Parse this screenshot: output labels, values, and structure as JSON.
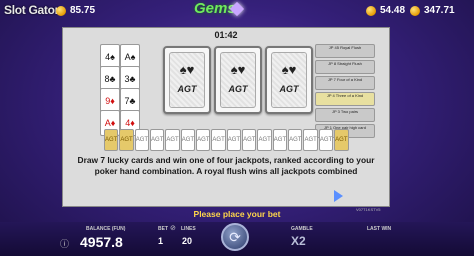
{
  "topbar": {
    "site_name": "Slot Gator",
    "left_balance": "85.75",
    "coin_value": "54.48",
    "total_value": "347.71",
    "game_logo": "Gems"
  },
  "game": {
    "timer": "01:42",
    "deck_cards": [
      "4♠",
      "A♠",
      "8♣",
      "3♣",
      "9♦",
      "7♣",
      "A♦",
      "4♦"
    ],
    "deck_colors": [
      "black",
      "black",
      "black",
      "black",
      "red",
      "black",
      "red",
      "red"
    ],
    "big_cards": [
      "AGT",
      "AGT",
      "AGT"
    ],
    "jackpots": [
      {
        "label": "JP 45 Royal Flush",
        "highlight": false
      },
      {
        "label": "JP 8 Straight Flush",
        "highlight": false
      },
      {
        "label": "JP 7 Four of a Kind",
        "highlight": false
      },
      {
        "label": "JP 4 Three of a Kind",
        "highlight": true
      },
      {
        "label": "JP 3 Two pairs",
        "highlight": false
      },
      {
        "label": "JP 1 One pair high card",
        "highlight": false
      }
    ],
    "row_cards": [
      "AGT",
      "AGT",
      "AGT",
      "AGT",
      "AGT",
      "AGT",
      "AGT",
      "AGT",
      "AGT",
      "AGT",
      "AGT",
      "AGT",
      "AGT",
      "AGT",
      "AGT",
      "AGT"
    ],
    "row_gold_flags": [
      true,
      true,
      false,
      false,
      false,
      false,
      false,
      false,
      false,
      false,
      false,
      false,
      false,
      false,
      false,
      true
    ],
    "message": "Draw 7 lucky cards and win one of four jackpots, ranked according to your poker hand combination. A royal flush wins all jackpots combined",
    "place_bet": "Please place your bet",
    "version": "V07T1KSTV5"
  },
  "bottom": {
    "balance_label": "BALANCE (FUN)",
    "balance_value": "4957.8",
    "bet_label": "BET",
    "bet_value": "1",
    "lines_label": "LINES",
    "lines_value": "20",
    "gamble_label": "GAMBLE",
    "gamble_value": "X2",
    "last_win_label": "LAST WIN",
    "last_win_value": ""
  }
}
